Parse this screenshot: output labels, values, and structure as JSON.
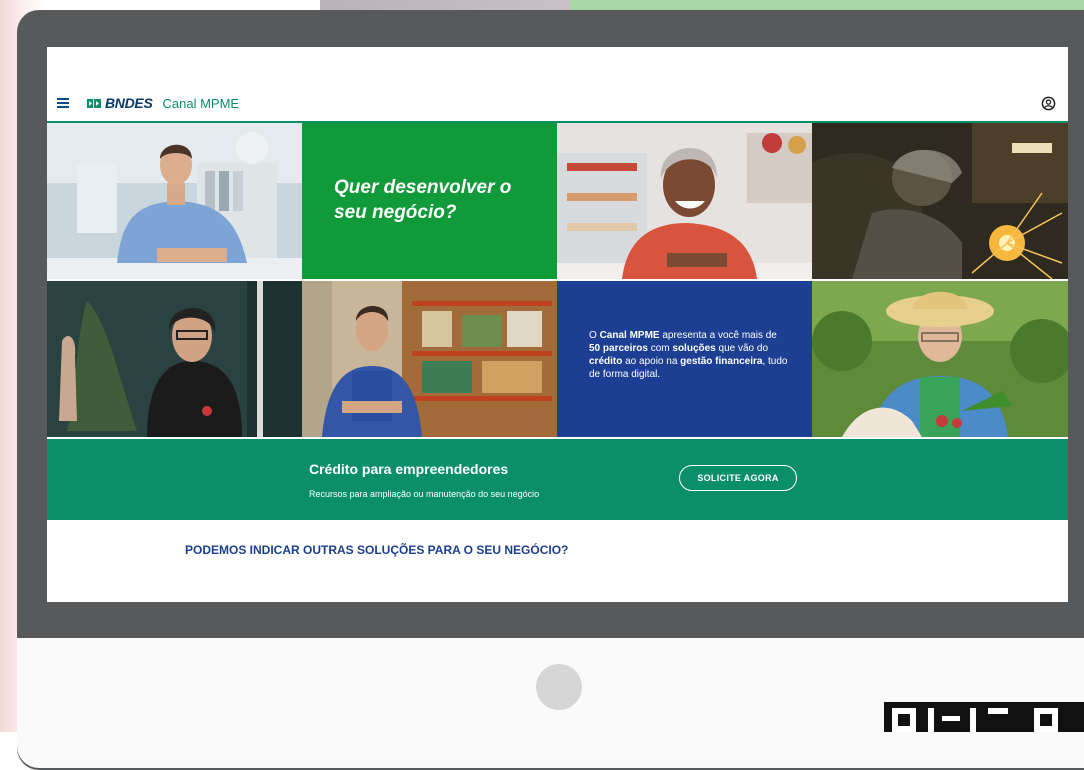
{
  "app": {
    "brand": "BNDES",
    "channel": "Canal MPME"
  },
  "hero": {
    "title": "Quer desenvolver o seu negócio?",
    "description_parts": {
      "p1": "O ",
      "b1": "Canal MPME",
      "p2": " apresenta a você mais de ",
      "b2": "50 parceiros",
      "p3": " com ",
      "b3": "soluções",
      "p4": " que vão do ",
      "b4": "crédito",
      "p5": " ao apoio na ",
      "b5": "gestão financeira",
      "p6": ", tudo de forma digital."
    }
  },
  "credit": {
    "title": "Crédito para empreendedores",
    "subtitle": "Recursos para ampliação ou manutenção do seu negócio",
    "cta_label": "SOLICITE AGORA"
  },
  "more_solutions_link": "PODEMOS INDICAR OUTRAS SOLUÇÕES PARA O SEU NEGÓCIO?",
  "colors": {
    "brand_green": "#0a8f6a",
    "hero_green": "#119a39",
    "hero_blue": "#1c3f93",
    "navy_text": "#1b3f8c"
  },
  "icons": {
    "menu": "hamburger-menu-icon",
    "logo": "bndes-logo-mark-icon",
    "user": "user-account-icon"
  }
}
